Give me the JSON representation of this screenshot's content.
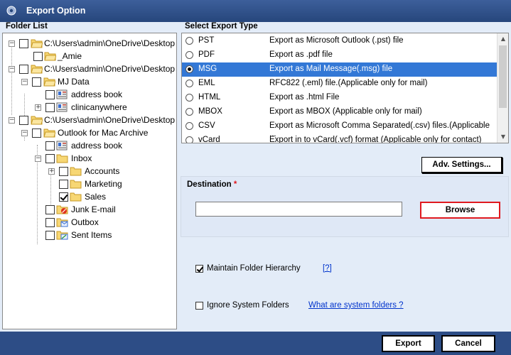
{
  "window": {
    "title": "Export Option"
  },
  "folder_list": {
    "label": "Folder List",
    "items": [
      {
        "label": "C:\\Users\\admin\\OneDrive\\Desktop"
      },
      {
        "label": "_Amie"
      },
      {
        "label": "C:\\Users\\admin\\OneDrive\\Desktop"
      },
      {
        "label": "MJ Data"
      },
      {
        "label": "address book"
      },
      {
        "label": "clinicanywhere"
      },
      {
        "label": "C:\\Users\\admin\\OneDrive\\Desktop"
      },
      {
        "label": "Outlook for Mac Archive"
      },
      {
        "label": "address book"
      },
      {
        "label": "Inbox"
      },
      {
        "label": "Accounts"
      },
      {
        "label": "Marketing"
      },
      {
        "label": "Sales",
        "checked": true
      },
      {
        "label": "Junk E-mail"
      },
      {
        "label": "Outbox"
      },
      {
        "label": "Sent Items"
      }
    ]
  },
  "export_type": {
    "label": "Select Export Type",
    "selected": "MSG",
    "options": [
      {
        "name": "PST",
        "desc": "Export as Microsoft Outlook (.pst) file"
      },
      {
        "name": "PDF",
        "desc": "Export as .pdf file"
      },
      {
        "name": "MSG",
        "desc": "Export as Mail Message(.msg) file"
      },
      {
        "name": "EML",
        "desc": "RFC822 (.eml) file.(Applicable only for mail)"
      },
      {
        "name": "HTML",
        "desc": "Export as .html File"
      },
      {
        "name": "MBOX",
        "desc": "Export as MBOX (Applicable only for mail)"
      },
      {
        "name": "CSV",
        "desc": "Export as Microsoft Comma Separated(.csv) files.(Applicable ..."
      },
      {
        "name": "vCard",
        "desc": "Export in to vCard(.vcf) format (Applicable only for contact)"
      }
    ]
  },
  "adv_settings": {
    "label": "Adv. Settings..."
  },
  "destination": {
    "label": "Destination",
    "required_mark": "*",
    "value": "",
    "browse_label": "Browse"
  },
  "options": {
    "maintain_hierarchy": {
      "label": "Maintain Folder Hierarchy",
      "checked": true,
      "help": "[?]"
    },
    "ignore_system": {
      "label": "Ignore System Folders",
      "checked": false,
      "help_link": "What are system folders ?"
    }
  },
  "footer": {
    "export_label": "Export",
    "cancel_label": "Cancel"
  },
  "colors": {
    "title_bar": "#2b4a82",
    "selection": "#3378d6",
    "highlight_border": "#e0191f",
    "link": "#0033cc"
  }
}
